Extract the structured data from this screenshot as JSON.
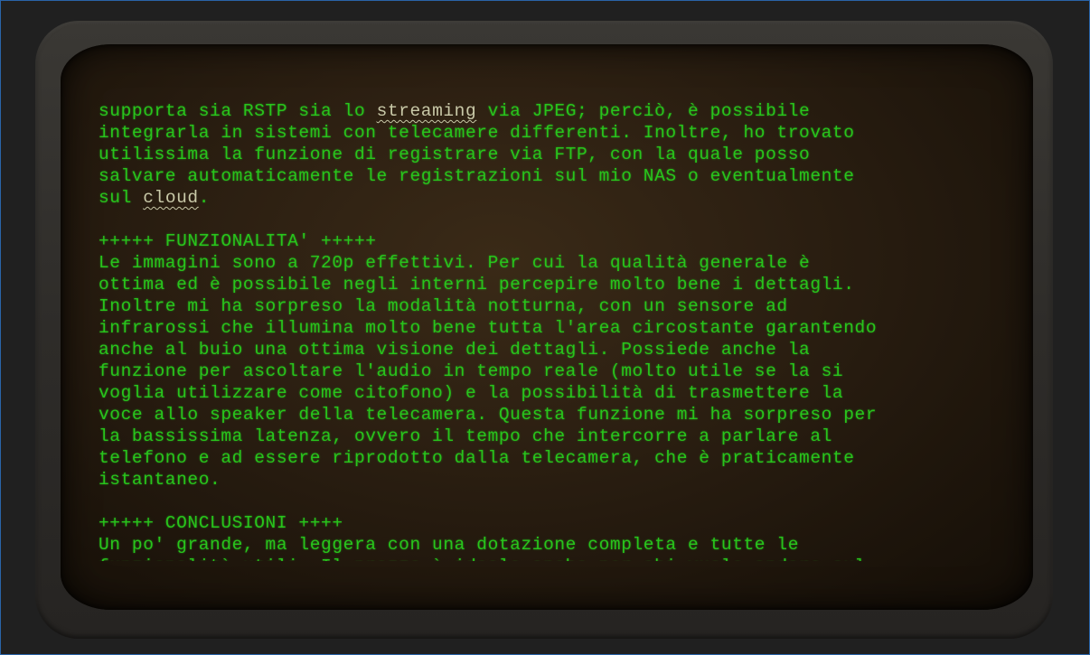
{
  "terminal": {
    "lines": [
      {
        "parts": [
          "supporta sia RSTP sia lo ",
          "",
          " via JPEG; perciò, è possibile"
        ],
        "spell": "streaming"
      },
      {
        "text": "integrarla in sistemi con telecamere differenti. Inoltre, ho trovato"
      },
      {
        "text": "utilissima la funzione di registrare via FTP, con la quale posso"
      },
      {
        "text": "salvare automaticamente le registrazioni sul mio NAS o eventualmente"
      },
      {
        "parts": [
          "sul ",
          "",
          "."
        ],
        "spell": "cloud"
      },
      {
        "text": ""
      },
      {
        "text": "+++++ FUNZIONALITA' +++++"
      },
      {
        "text": "Le immagini sono a 720p effettivi. Per cui la qualità generale è"
      },
      {
        "text": "ottima ed è possibile negli interni percepire molto bene i dettagli."
      },
      {
        "text": "Inoltre mi ha sorpreso la modalità notturna, con un sensore ad"
      },
      {
        "text": "infrarossi che illumina molto bene tutta l'area circostante garantendo"
      },
      {
        "text": "anche al buio una ottima visione dei dettagli. Possiede anche la"
      },
      {
        "text": "funzione per ascoltare l'audio in tempo reale (molto utile se la si"
      },
      {
        "text": "voglia utilizzare come citofono) e la possibilità di trasmettere la"
      },
      {
        "text": "voce allo speaker della telecamera. Questa funzione mi ha sorpreso per"
      },
      {
        "text": "la bassissima latenza, ovvero il tempo che intercorre a parlare al"
      },
      {
        "text": "telefono e ad essere riprodotto dalla telecamera, che è praticamente"
      },
      {
        "text": "istantaneo."
      },
      {
        "text": ""
      },
      {
        "text": "+++++ CONCLUSIONI ++++"
      },
      {
        "text": "Un po' grande, ma leggera con una dotazione completa e tutte le"
      },
      {
        "text": "funzionalità utili. Il prezzo è ideale anche per chi vuole andare sul"
      }
    ]
  }
}
